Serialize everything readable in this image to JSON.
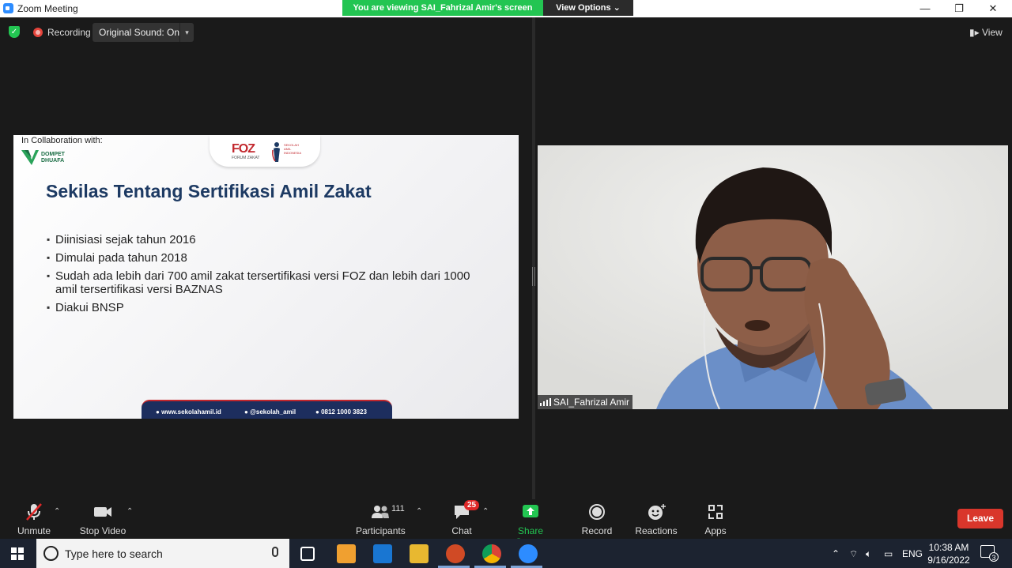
{
  "window": {
    "title": "Zoom Meeting",
    "banner": "You are viewing SAI_Fahrizal Amir's screen",
    "view_options": "View Options",
    "minimize": "—",
    "restore": "❐",
    "close": "✕"
  },
  "topbar": {
    "recording": "Recording",
    "original_sound": "Original Sound: On",
    "view": "View"
  },
  "slide": {
    "collab": "In Collaboration with:",
    "dd_line1": "DOMPET",
    "dd_line2": "DHUAFA",
    "foz": "FOZ",
    "foz_sub": "FORUM ZAKAT",
    "sai_line1": "SEKOLAH",
    "sai_line2": "AMIL",
    "sai_line3": "INDONESIA",
    "heading": "Sekilas Tentang Sertifikasi Amil Zakat",
    "bullets": [
      "Diinisiasi sejak tahun 2016",
      "Dimulai pada tahun 2018",
      "Sudah ada lebih dari 700 amil zakat tersertifikasi versi FOZ dan lebih dari 1000 amil tersertifikasi versi BAZNAS",
      "Diakui BNSP"
    ],
    "footer": {
      "website": "www.sekolahamil.id",
      "instagram": "@sekolah_amil",
      "phone": "0812 1000 3823"
    }
  },
  "video": {
    "name": "SAI_Fahrizal Amir"
  },
  "toolbar": {
    "unmute": "Unmute",
    "stop_video": "Stop Video",
    "participants": "Participants",
    "participants_count": "111",
    "chat": "Chat",
    "chat_badge": "25",
    "share_screen": "Share Screen",
    "record": "Record",
    "reactions": "Reactions",
    "apps": "Apps",
    "leave": "Leave"
  },
  "taskbar": {
    "search_placeholder": "Type here to search",
    "language": "ENG",
    "time": "10:38 AM",
    "date": "9/16/2022",
    "notification_count": "3"
  },
  "colors": {
    "banner_green": "#23c552",
    "leave_red": "#d9362b",
    "slide_heading": "#1d3a63",
    "share_green": "#23c552"
  }
}
